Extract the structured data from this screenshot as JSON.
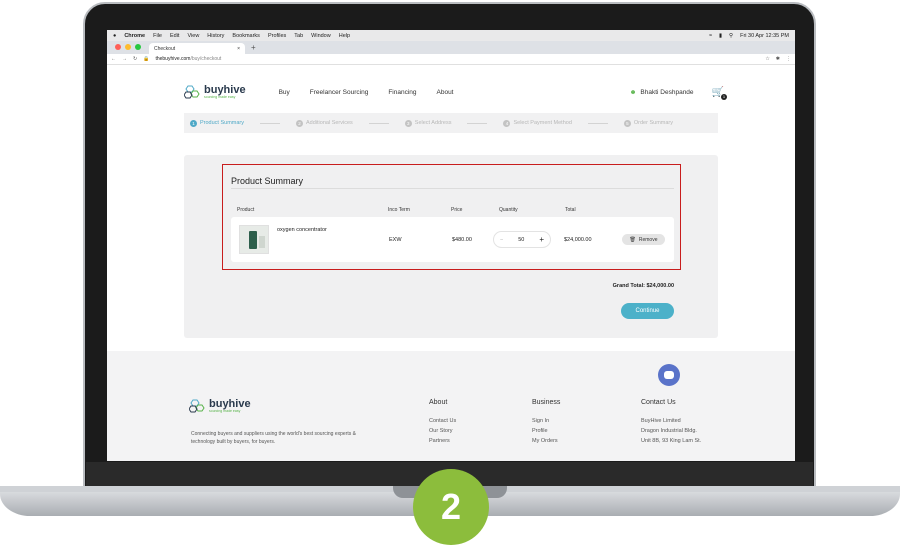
{
  "menubar": {
    "app": "Chrome",
    "items": [
      "File",
      "Edit",
      "View",
      "History",
      "Bookmarks",
      "Profiles",
      "Tab",
      "Window",
      "Help"
    ],
    "clock": "Fri 30 Apr 12:35 PM"
  },
  "browser": {
    "tab_title": "Checkout",
    "tab_close": "×",
    "new_tab": "+",
    "url_host": "thebuyhive.com",
    "url_path": "/buy/checkout"
  },
  "site": {
    "logo_word": "buyhive",
    "logo_tag": "sourcing made easy",
    "nav": [
      "Buy",
      "Freelancer Sourcing",
      "Financing",
      "About"
    ],
    "user_name": "Bhakti Deshpande",
    "cart_count": "1"
  },
  "steps": [
    {
      "n": "1",
      "label": "Product Summary"
    },
    {
      "n": "2",
      "label": "Additional Services"
    },
    {
      "n": "3",
      "label": "Select Address"
    },
    {
      "n": "4",
      "label": "Select Payment Method"
    },
    {
      "n": "5",
      "label": "Order Summary"
    }
  ],
  "summary": {
    "title": "Product Summary",
    "headers": {
      "product": "Product",
      "inco": "Inco Term",
      "price": "Price",
      "quantity": "Quantity",
      "total": "Total"
    },
    "item": {
      "name": "oxygen concentrator",
      "inco": "EXW",
      "price": "$480.00",
      "quantity": "50",
      "minus": "−",
      "plus": "+",
      "total": "$24,000.00",
      "remove": "Remove"
    },
    "grand_total": "Grand Total: $24,000.00",
    "continue": "Continue"
  },
  "footer": {
    "tagline": "Connecting buyers and suppliers using the world's best sourcing experts & technology built by buyers, for buyers.",
    "about": {
      "title": "About",
      "links": [
        "Contact Us",
        "Our Story",
        "Partners"
      ]
    },
    "business": {
      "title": "Business",
      "links": [
        "Sign In",
        "Profile",
        "My Orders"
      ]
    },
    "contact": {
      "title": "Contact Us",
      "lines": [
        "BuyHive Limited",
        "Dragon Industrial Bldg.",
        "Unit 8B, 93 King Lam St."
      ]
    }
  },
  "step_badge": "2",
  "colors": {
    "accent": "#4cb1c9",
    "highlight": "#c81d1d",
    "brand_green": "#8cbd3c"
  }
}
